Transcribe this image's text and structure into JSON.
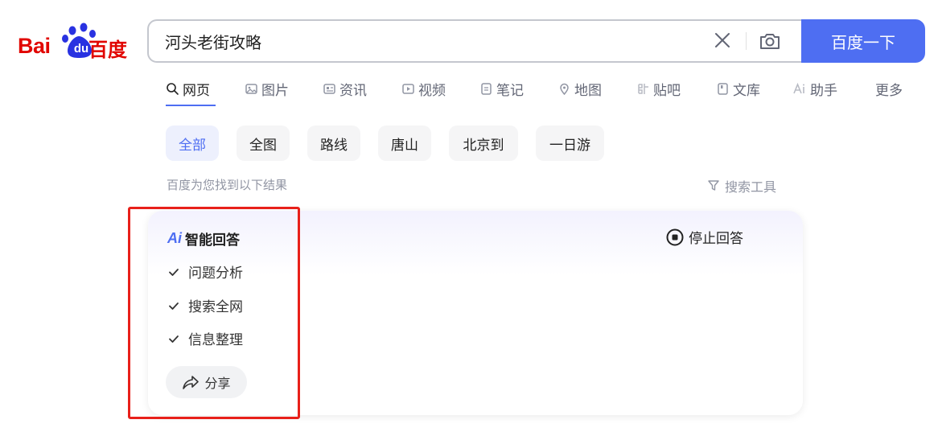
{
  "logo": {
    "text_bai": "Bai",
    "text_du": "du",
    "text_cn": "百度",
    "brand_color": "#e10601",
    "paw_color": "#2932e1"
  },
  "search": {
    "query": "河头老街攻略",
    "button_label": "百度一下",
    "clear_icon": "close-icon",
    "camera_icon": "camera-icon",
    "accent": "#4e6ef2"
  },
  "tabs": [
    {
      "label": "网页",
      "icon": "search-icon",
      "active": true
    },
    {
      "label": "图片",
      "icon": "image-icon"
    },
    {
      "label": "资讯",
      "icon": "news-icon"
    },
    {
      "label": "视频",
      "icon": "video-icon"
    },
    {
      "label": "笔记",
      "icon": "note-icon"
    },
    {
      "label": "地图",
      "icon": "map-icon"
    },
    {
      "label": "贴吧",
      "icon": "tieba-icon"
    },
    {
      "label": "文库",
      "icon": "document-icon"
    },
    {
      "label": "助手",
      "icon": "ai-icon"
    },
    {
      "label": "更多"
    }
  ],
  "filters": [
    {
      "label": "全部",
      "active": true
    },
    {
      "label": "全图"
    },
    {
      "label": "路线"
    },
    {
      "label": "唐山"
    },
    {
      "label": "北京到"
    },
    {
      "label": "一日游"
    }
  ],
  "result_info": {
    "count_text": "百度为您找到以下结果",
    "tools_label": "搜索工具"
  },
  "ai_answer": {
    "logo": "Ai",
    "title": "智能回答",
    "stop_label": "停止回答",
    "steps": [
      "问题分析",
      "搜索全网",
      "信息整理"
    ],
    "share_label": "分享"
  }
}
